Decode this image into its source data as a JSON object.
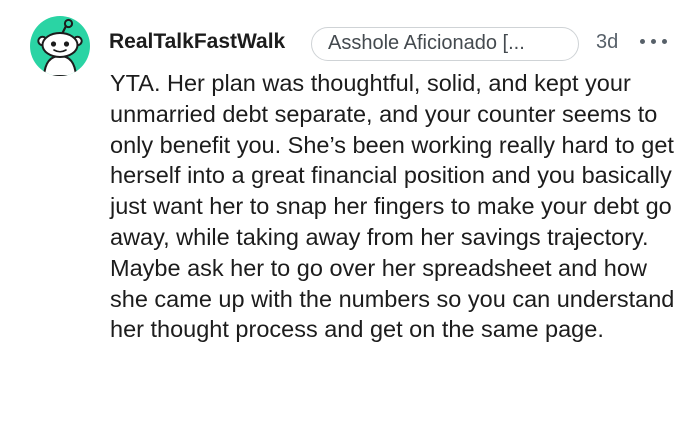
{
  "comment": {
    "username": "RealTalkFastWalk",
    "flair": "Asshole Aficionado [...",
    "timestamp": "3d",
    "more_icon": "more-horizontal-icon",
    "avatar_icon": "snoo-avatar-icon",
    "avatar_color": "#2ad4a4",
    "body": "YTA. Her plan was thoughtful, solid, and kept your unmarried debt separate, and your counter seems to only benefit you. She’s been working really hard to get herself into a great financial position and you basically just want her to snap her fingers to make your debt go away, while taking away from her savings trajectory. Maybe ask her to go over her spreadsheet and how she came up with the numbers so you can understand her thought process and get on the same page."
  }
}
